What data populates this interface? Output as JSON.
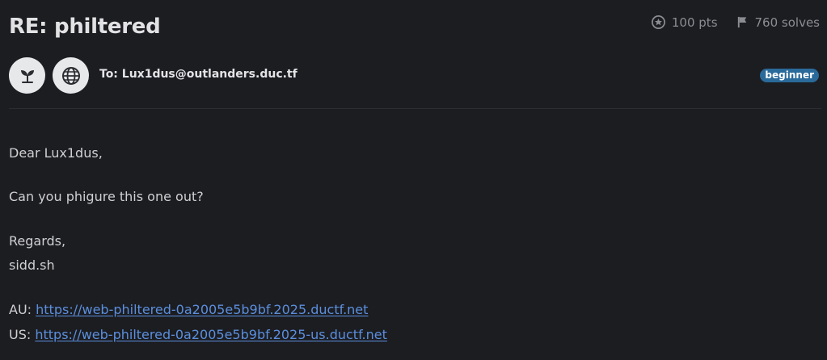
{
  "challenge": {
    "title": "RE: philtered",
    "points": "100 pts",
    "solves": "760 solves",
    "to": "To: Lux1dus@outlanders.duc.tf",
    "difficulty": "beginner"
  },
  "message": {
    "greeting": "Dear Lux1dus,",
    "question": "Can you phigure this one out?",
    "regards": "Regards,",
    "signature": "sidd.sh",
    "links": [
      {
        "prefix": "AU:",
        "url": "https://web-philtered-0a2005e5b9bf.2025.ductf.net"
      },
      {
        "prefix": "US:",
        "url": "https://web-philtered-0a2005e5b9bf.2025-us.ductf.net"
      }
    ]
  },
  "icons": {
    "points": "star-circle-icon",
    "solves": "flag-icon",
    "category_beginner": "sprout-icon",
    "category_web": "globe-icon"
  },
  "colors": {
    "background": "#1c1d21",
    "badge": "#2a6a9a",
    "link": "#5b8fde"
  }
}
